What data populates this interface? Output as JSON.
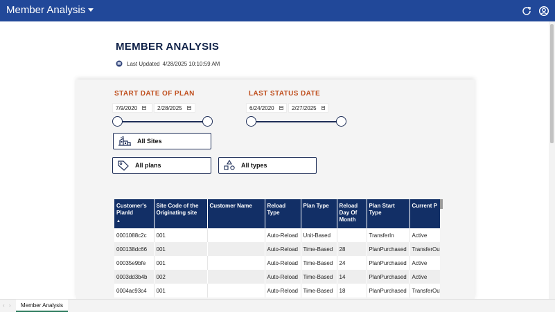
{
  "app": {
    "title": "Member Analysis"
  },
  "header": {
    "title": "MEMBER ANALYSIS",
    "last_updated_label": "Last Updated",
    "last_updated_value": "4/28/2025 10:10:59 AM"
  },
  "filters": {
    "start_date": {
      "title": "START DATE OF PLAN",
      "from": "7/9/2020",
      "to": "2/28/2025"
    },
    "last_status": {
      "title": "LAST STATUS DATE",
      "from": "6/24/2020",
      "to": "2/27/2025"
    },
    "sites_label": "All Sites",
    "plans_label": "All plans",
    "types_label": "All types"
  },
  "table": {
    "columns": [
      "Customer's PlanId",
      "Site Code of the Originating site",
      "Customer Name",
      "Reload Type",
      "Plan Type",
      "Reload Day Of Month",
      "Plan Start Type",
      "Current P"
    ],
    "sort_indicator": "▲",
    "rows": [
      [
        "0001088c2c",
        "001",
        "",
        "Auto-Reload",
        "Unit-Based",
        "",
        "TransferIn",
        "Active"
      ],
      [
        "000138dc66",
        "001",
        "",
        "Auto-Reload",
        "Time-Based",
        "28",
        "PlanPurchased",
        "TransferOut"
      ],
      [
        "00035e9bfe",
        "001",
        "",
        "Auto-Reload",
        "Time-Based",
        "24",
        "PlanPurchased",
        "Active"
      ],
      [
        "0003dd3b4b",
        "002",
        "",
        "Auto-Reload",
        "Time-Based",
        "14",
        "PlanPurchased",
        "Active"
      ],
      [
        "0004ac93c4",
        "001",
        "",
        "Auto-Reload",
        "Time-Based",
        "18",
        "PlanPurchased",
        "TransferOut"
      ]
    ]
  },
  "tabs": [
    {
      "label": "Member Analysis"
    }
  ],
  "colors": {
    "topbar": "#214899",
    "accent_orange": "#c0501f",
    "table_header": "#122f66",
    "active_tab_underline": "#2c7a5d"
  }
}
